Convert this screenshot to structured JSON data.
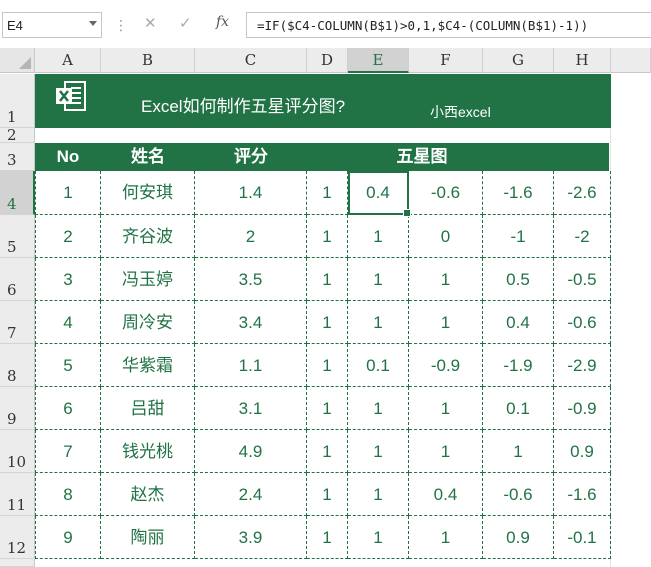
{
  "formula_bar": {
    "name_box": "E4",
    "cancel_icon": "✕",
    "enter_icon": "✓",
    "fx_label": "fx",
    "formula": "=IF($C4-COLUMN(B$1)>0,1,$C4-(COLUMN(B$1)-1))"
  },
  "columns": [
    "A",
    "B",
    "C",
    "D",
    "E",
    "F",
    "G",
    "H"
  ],
  "rows": [
    "1",
    "2",
    "3",
    "4",
    "5",
    "6",
    "7",
    "8",
    "9",
    "10",
    "11",
    "12"
  ],
  "banner": {
    "title": "Excel如何制作五星评分图?",
    "subtitle": "小西excel",
    "color": "#217346"
  },
  "table": {
    "headers": {
      "no": "No",
      "name": "姓名",
      "score": "评分",
      "stars": "五星图"
    },
    "rows": [
      [
        "1",
        "何安琪",
        "1.4",
        "1",
        "0.4",
        "-0.6",
        "-1.6",
        "-2.6"
      ],
      [
        "2",
        "齐谷波",
        "2",
        "1",
        "1",
        "0",
        "-1",
        "-2"
      ],
      [
        "3",
        "冯玉婷",
        "3.5",
        "1",
        "1",
        "1",
        "0.5",
        "-0.5"
      ],
      [
        "4",
        "周冷安",
        "3.4",
        "1",
        "1",
        "1",
        "0.4",
        "-0.6"
      ],
      [
        "5",
        "华紫霜",
        "1.1",
        "1",
        "0.1",
        "-0.9",
        "-1.9",
        "-2.9"
      ],
      [
        "6",
        "吕甜",
        "3.1",
        "1",
        "1",
        "1",
        "0.1",
        "-0.9"
      ],
      [
        "7",
        "钱光桃",
        "4.9",
        "1",
        "1",
        "1",
        "1",
        "0.9"
      ],
      [
        "8",
        "赵杰",
        "2.4",
        "1",
        "1",
        "0.4",
        "-0.6",
        "-1.6"
      ],
      [
        "9",
        "陶丽",
        "3.9",
        "1",
        "1",
        "1",
        "0.9",
        "-0.1"
      ]
    ]
  },
  "selected_cell": "E4"
}
